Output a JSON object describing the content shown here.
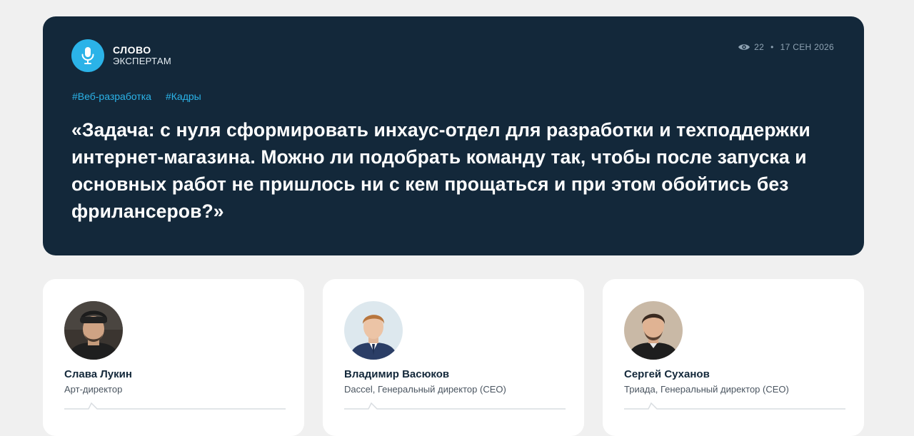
{
  "brand": {
    "line1": "СЛОВО",
    "line2": "ЭКСПЕРТАМ",
    "icon": "microphone-icon",
    "color": "#2bb3e8"
  },
  "meta": {
    "views": "22",
    "separator": "•",
    "date": "17 СЕН 2026",
    "icon": "eye-icon"
  },
  "tags": [
    "#Веб-разработка",
    "#Кадры"
  ],
  "question": "«Задача: с нуля сформировать инхаус-отдел для разработки и техподдержки интернет-магазина. Можно ли подобрать команду так, чтобы после запуска и основных работ не пришлось ни с кем прощаться и при этом обойтись без фрилансеров?»",
  "experts": [
    {
      "name": "Слава Лукин",
      "role": "Арт-директор"
    },
    {
      "name": "Владимир Васюков",
      "role": "Daccel, Генеральный директор (CEO)"
    },
    {
      "name": "Сергей Суханов",
      "role": "Триада, Генеральный директор (CEO)"
    }
  ]
}
